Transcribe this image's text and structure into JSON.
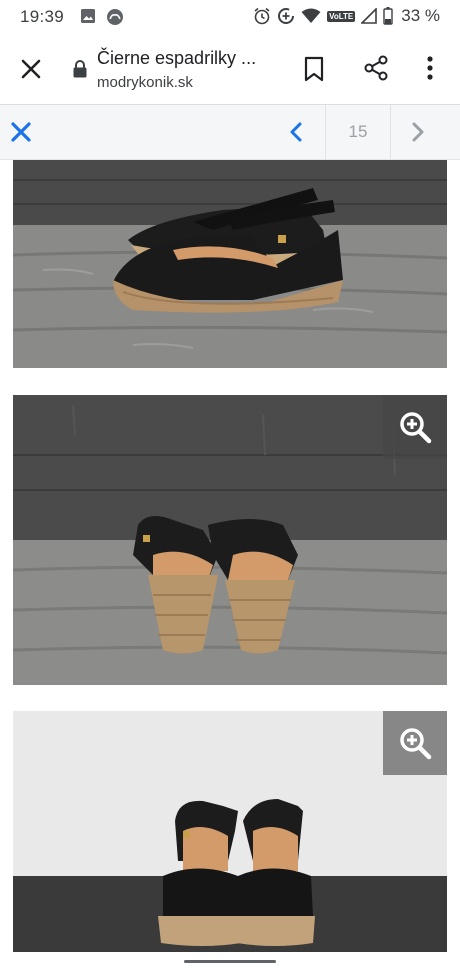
{
  "status_bar": {
    "time": "19:39",
    "battery": "33 %",
    "network_badge": "VoLTE",
    "icons": [
      "gallery-icon",
      "app-notification-icon",
      "alarm-icon",
      "data-saver-icon",
      "wifi-icon",
      "signal-icon",
      "battery-icon"
    ]
  },
  "toolbar": {
    "title": "Čierne espadrilky ...",
    "domain": "modrykonik.sk",
    "icons": [
      "close-icon",
      "lock-icon",
      "bookmark-icon",
      "share-icon",
      "more-vert-icon"
    ]
  },
  "gallery": {
    "counter": "15",
    "accent": "#1a73e8",
    "photos": [
      {
        "name": "photo-side-view",
        "zoom": false
      },
      {
        "name": "photo-back-view",
        "zoom": true
      },
      {
        "name": "photo-front-view",
        "zoom": true
      }
    ]
  }
}
